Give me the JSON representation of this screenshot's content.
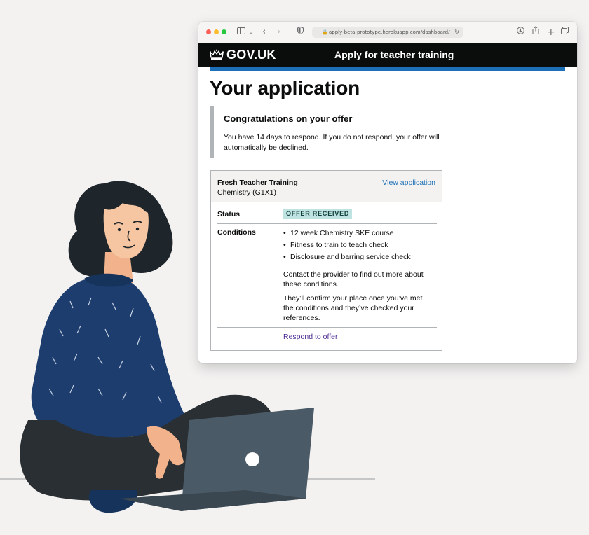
{
  "browser": {
    "url": "apply-beta-prototype.herokuapp.com/dashboard/",
    "icons": [
      "sidebar-icon",
      "chevron-down-icon",
      "back-icon",
      "forward-icon",
      "privacy-shield-icon",
      "lock-icon",
      "reload-icon",
      "download-icon",
      "share-icon",
      "new-tab-icon",
      "tabs-overview-icon"
    ]
  },
  "header": {
    "logo_text": "GOV.UK",
    "service_name": "Apply for teacher training"
  },
  "page": {
    "title": "Your application"
  },
  "inset": {
    "title": "Congratulations on your offer",
    "body": "You have 14 days to respond. If you do not respond, your offer will automatically be declined."
  },
  "card": {
    "provider": "Fresh Teacher Training",
    "course": "Chemistry (G1X1)",
    "view_link": "View application",
    "status_label": "Status",
    "status_tag": "Offer received",
    "conditions_label": "Conditions",
    "conditions": [
      "12 week Chemistry SKE course",
      "Fitness to train to teach check",
      "Disclosure and barring service check"
    ],
    "contact_text": "Contact the provider to find out more about these conditions.",
    "confirm_text": "They’ll confirm your place once you’ve met the conditions and they’ve checked your references.",
    "respond_link": "Respond to offer"
  },
  "colors": {
    "header_bg": "#0b0c0c",
    "brand_blue": "#1d70b8",
    "link": "#1d70b8",
    "visited_link": "#4c2c92",
    "tag_bg": "#bfe3e0",
    "tag_text": "#10403c",
    "page_bg": "#f3f2f1"
  }
}
